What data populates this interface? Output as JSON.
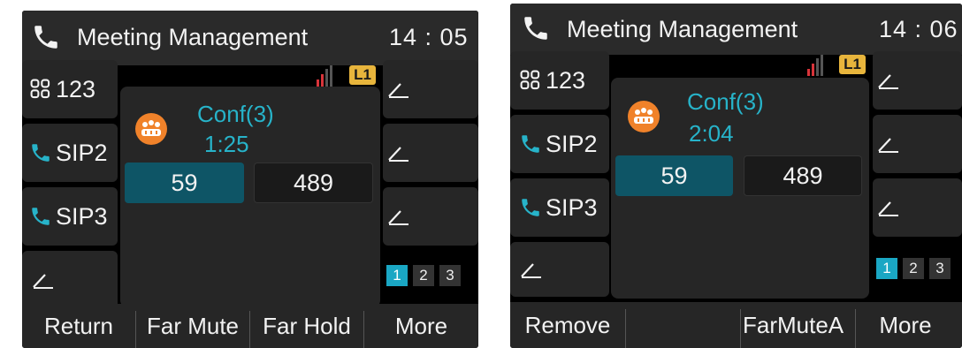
{
  "screens": [
    {
      "title": "Meeting Management",
      "clock": "14 : 05",
      "line_label": "L1",
      "left_keys": [
        {
          "label": "123",
          "icon": "dialpad-icon"
        },
        {
          "label": "SIP2",
          "icon": "phone-icon"
        },
        {
          "label": "SIP3",
          "icon": "phone-icon"
        },
        {
          "label": "",
          "icon": "edit-icon"
        }
      ],
      "right_keys": [
        {
          "icon": "edit-icon"
        },
        {
          "icon": "edit-icon"
        },
        {
          "icon": "edit-icon"
        }
      ],
      "pages": [
        "1",
        "2",
        "3"
      ],
      "active_page": "1",
      "conference": {
        "name": "Conf(3)",
        "duration": "1:25",
        "parties": [
          "59",
          "489"
        ],
        "selected_party": "59"
      },
      "softkeys": [
        "Return",
        "Far Mute",
        "Far Hold",
        "More"
      ]
    },
    {
      "title": "Meeting Management",
      "clock": "14 : 06",
      "line_label": "L1",
      "left_keys": [
        {
          "label": "123",
          "icon": "dialpad-icon"
        },
        {
          "label": "SIP2",
          "icon": "phone-icon"
        },
        {
          "label": "SIP3",
          "icon": "phone-icon"
        },
        {
          "label": "",
          "icon": "edit-icon"
        }
      ],
      "right_keys": [
        {
          "icon": "edit-icon"
        },
        {
          "icon": "edit-icon"
        },
        {
          "icon": "edit-icon"
        }
      ],
      "pages": [
        "1",
        "2",
        "3"
      ],
      "active_page": "1",
      "conference": {
        "name": "Conf(3)",
        "duration": "2:04",
        "parties": [
          "59",
          "489"
        ],
        "selected_party": "59"
      },
      "softkeys": [
        "Remove",
        "",
        "FarMuteA",
        "More"
      ]
    }
  ],
  "colors": {
    "accent_teal": "#27b3c9",
    "selected_party_bg": "#0e5566",
    "conference_icon": "#f0822a",
    "line_badge": "#e8b53c",
    "active_page": "#1aa7c4"
  }
}
